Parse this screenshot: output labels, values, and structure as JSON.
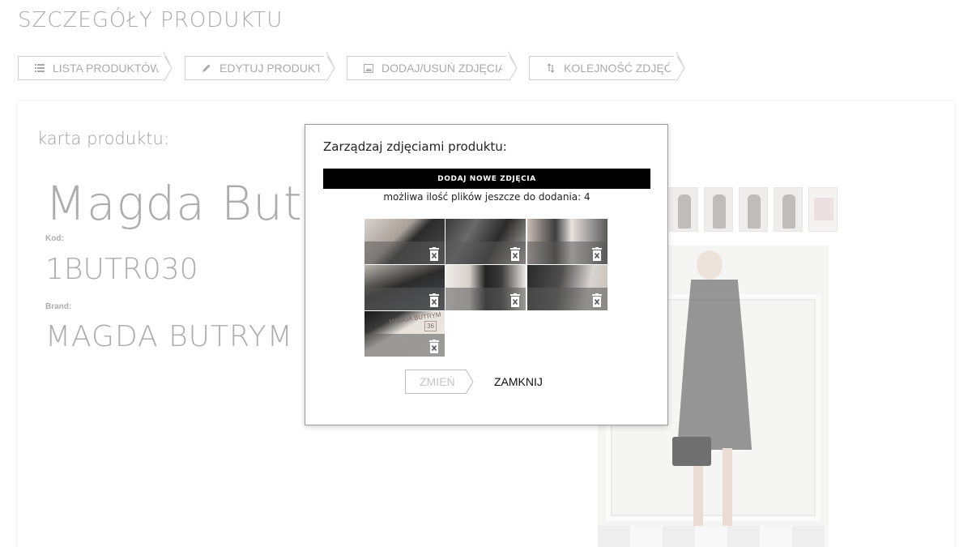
{
  "page": {
    "title": "SZCZEGÓŁY PRODUKTU"
  },
  "tabs": [
    {
      "label": "LISTA PRODUKTÓW",
      "icon": "list-icon"
    },
    {
      "label": "EDYTUJ PRODUKT",
      "icon": "pencil-icon"
    },
    {
      "label": "DODAJ/USUŃ ZDJĘCIA",
      "icon": "image-icon"
    },
    {
      "label": "KOLEJNOŚĆ ZDJĘĆ",
      "icon": "sort-arrows-icon"
    }
  ],
  "card": {
    "label": "karta produktu:",
    "product_name": "Magda Butrym",
    "code_label": "Kod:",
    "code_value": "1BUTR030",
    "brand_label": "Brand:",
    "brand_value": "MAGDA BUTRYM"
  },
  "modal": {
    "title": "Zarządzaj zdjęciami produktu:",
    "add_button": "DODAJ NOWE ZDJĘCIA",
    "files_note": "możliwa ilość plików jeszcze do dodania: 4",
    "photo_tag_text": "MAGDA BUTRYM",
    "photo_tag_number": "36",
    "change_button": "ZMIEŃ",
    "close_button": "ZAMKNIJ",
    "delete_icon": "trash-icon"
  }
}
